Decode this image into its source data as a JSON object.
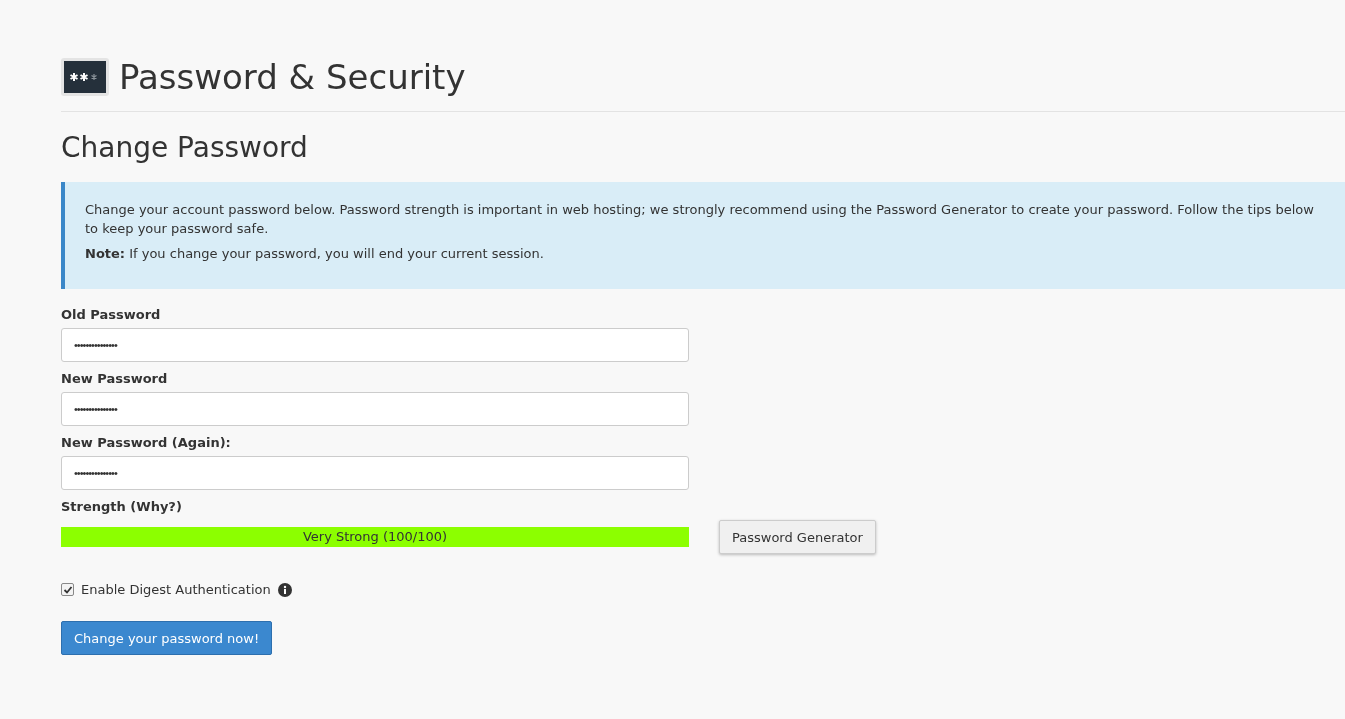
{
  "page_title": "Password & Security",
  "section_title": "Change Password",
  "info": {
    "text": "Change your account password below. Password strength is important in web hosting; we strongly recommend using the Password Generator to create your password. Follow the tips below to keep your password safe.",
    "note": "**Note:** If you change your password, you will end your current session."
  },
  "fields": [
    {
      "label": "Old Password",
      "value": "•••••••••••••••"
    },
    {
      "label": "New Password",
      "value": "•••••••••••••••"
    },
    {
      "label": "New Password (Again):",
      "value": "•••••••••••••••"
    }
  ],
  "strength": {
    "label": "Strength (Why?)",
    "level": 1.0,
    "reading": "Very Strong (100/100)"
  },
  "generator_button": "Password Generator",
  "digest": {
    "label": "Enable Digest Authentication",
    "checked": true
  },
  "submit_button": "Change your password now!"
}
